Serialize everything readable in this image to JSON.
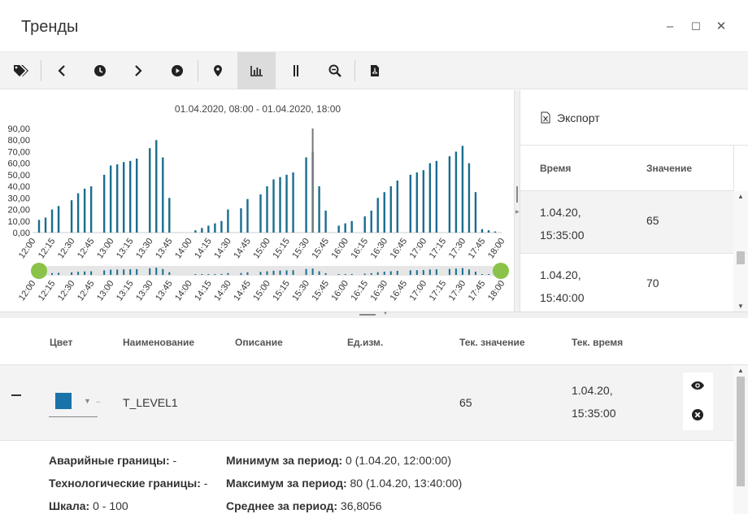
{
  "window": {
    "title": "Тренды",
    "minimize": "–",
    "maximize": "☐",
    "close": "✕"
  },
  "toolbar": {
    "items": [
      "tags-icon",
      "prev-icon",
      "clock-icon",
      "next-icon",
      "play-icon",
      "marker-icon",
      "bar-chart-icon",
      "cursor-lines-icon",
      "zoom-out-icon",
      "pdf-icon"
    ],
    "active": "bar-chart-icon"
  },
  "chart_data": {
    "type": "bar",
    "title": "01.04.2020, 08:00 - 01.04.2020, 18:00",
    "ylim": [
      0,
      90
    ],
    "yticks": [
      "0,00",
      "10,00",
      "20,00",
      "30,00",
      "40,00",
      "50,00",
      "60,00",
      "70,00",
      "80,00",
      "90,00"
    ],
    "xrange": [
      0,
      360
    ],
    "xticks": [
      "12:00",
      "12:15",
      "12:30",
      "12:45",
      "13:00",
      "13:15",
      "13:30",
      "13:45",
      "14:00",
      "14:15",
      "14:30",
      "14:45",
      "15:00",
      "15:15",
      "15:30",
      "15:45",
      "16:00",
      "16:15",
      "16:30",
      "16:45",
      "17:00",
      "17:15",
      "17:30",
      "17:45",
      "18:00"
    ],
    "bar_minutes": [
      5,
      10,
      15,
      20,
      30,
      35,
      40,
      45,
      55,
      60,
      65,
      70,
      75,
      80,
      90,
      95,
      100,
      105,
      125,
      130,
      135,
      140,
      145,
      150,
      160,
      165,
      175,
      180,
      185,
      190,
      195,
      200,
      210,
      215,
      220,
      225,
      235,
      240,
      245,
      255,
      260,
      265,
      270,
      275,
      280,
      290,
      295,
      300,
      305,
      310,
      320,
      325,
      330,
      335,
      340,
      345,
      350,
      355
    ],
    "values": [
      11,
      13,
      20,
      23,
      28,
      34,
      38,
      40,
      50,
      58,
      59,
      61,
      62,
      64,
      73,
      80,
      65,
      30,
      2,
      4,
      6,
      8,
      10,
      20,
      21,
      29,
      33,
      40,
      46,
      48,
      50,
      52,
      65,
      70,
      40,
      19,
      6,
      8,
      10,
      14,
      19,
      30,
      35,
      40,
      45,
      50,
      52,
      54,
      60,
      62,
      66,
      70,
      75,
      60,
      35,
      3,
      2,
      1
    ],
    "cursor_minute": 215,
    "series_color": "#1a6d8f"
  },
  "export": {
    "label": "Экспорт"
  },
  "history": {
    "col_time": "Время",
    "col_value": "Значение",
    "rows": [
      {
        "date": "1.04.20,",
        "time": "15:35:00",
        "value": "65"
      },
      {
        "date": "1.04.20,",
        "time": "15:40:00",
        "value": "70"
      }
    ]
  },
  "tags_table": {
    "headers": {
      "color": "Цвет",
      "name": "Наименование",
      "description": "Описание",
      "unit": "Ед.изм.",
      "current_value": "Тек. значение",
      "current_time": "Тек. время"
    },
    "row": {
      "color": "#1a73a8",
      "name": "T_LEVEL1",
      "current_value": "65",
      "date": "1.04.20,",
      "time": "15:35:00"
    },
    "details": {
      "alarm_key": "Аварийные границы:",
      "alarm_val": "-",
      "tech_key": "Технологические границы:",
      "tech_val": "-",
      "scale_key": "Шкала:",
      "scale_val": "0 - 100",
      "min_key": "Минимум за период:",
      "min_val": "0 (1.04.20, 12:00:00)",
      "max_key": "Максимум за период:",
      "max_val": "80 (1.04.20, 13:40:00)",
      "avg_key": "Среднее за период:",
      "avg_val": "36,8056"
    }
  }
}
